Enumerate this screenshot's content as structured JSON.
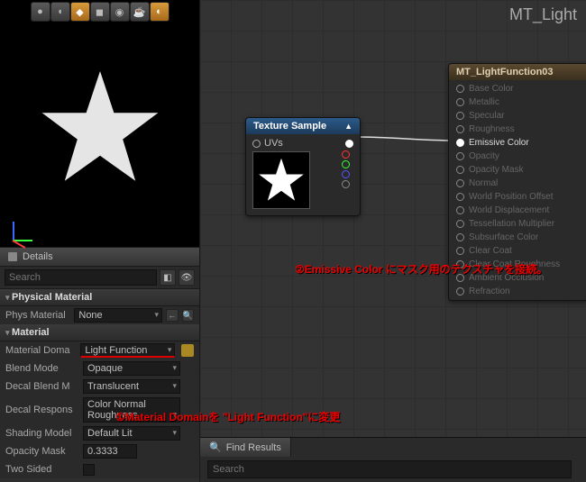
{
  "graph_title": "MT_Light",
  "details": {
    "tab_label": "Details",
    "search_placeholder": "Search"
  },
  "physical_material": {
    "header": "Physical Material",
    "phys_label": "Phys Material",
    "phys_value": "None"
  },
  "material": {
    "header": "Material",
    "domain_label": "Material Doma",
    "domain_value": "Light Function",
    "blend_label": "Blend Mode",
    "blend_value": "Opaque",
    "decal_label": "Decal Blend M",
    "decal_value": "Translucent",
    "response_label": "Decal Respons",
    "response_value": "Color Normal Roughness",
    "shading_label": "Shading Model",
    "shading_value": "Default Lit",
    "opacity_label": "Opacity Mask",
    "opacity_value": "0.3333",
    "twosided_label": "Two Sided"
  },
  "texsample": {
    "title": "Texture Sample",
    "uvs": "UVs"
  },
  "matnode": {
    "title": "MT_LightFunction03",
    "pins": [
      "Base Color",
      "Metallic",
      "Specular",
      "Roughness",
      "Emissive Color",
      "Opacity",
      "Opacity Mask",
      "Normal",
      "World Position Offset",
      "World Displacement",
      "Tessellation Multiplier",
      "Subsurface Color",
      "Clear Coat",
      "Clear Coat Roughness",
      "Ambient Occlusion",
      "Refraction"
    ],
    "active_pin_index": 4
  },
  "find": {
    "tab_label": "Find Results",
    "placeholder": "Search"
  },
  "annotations": {
    "a1": "①Material Domainを \"Light Function\"に変更",
    "a2": "②Emissive Color にマスク用のテクスチャを接続。"
  }
}
